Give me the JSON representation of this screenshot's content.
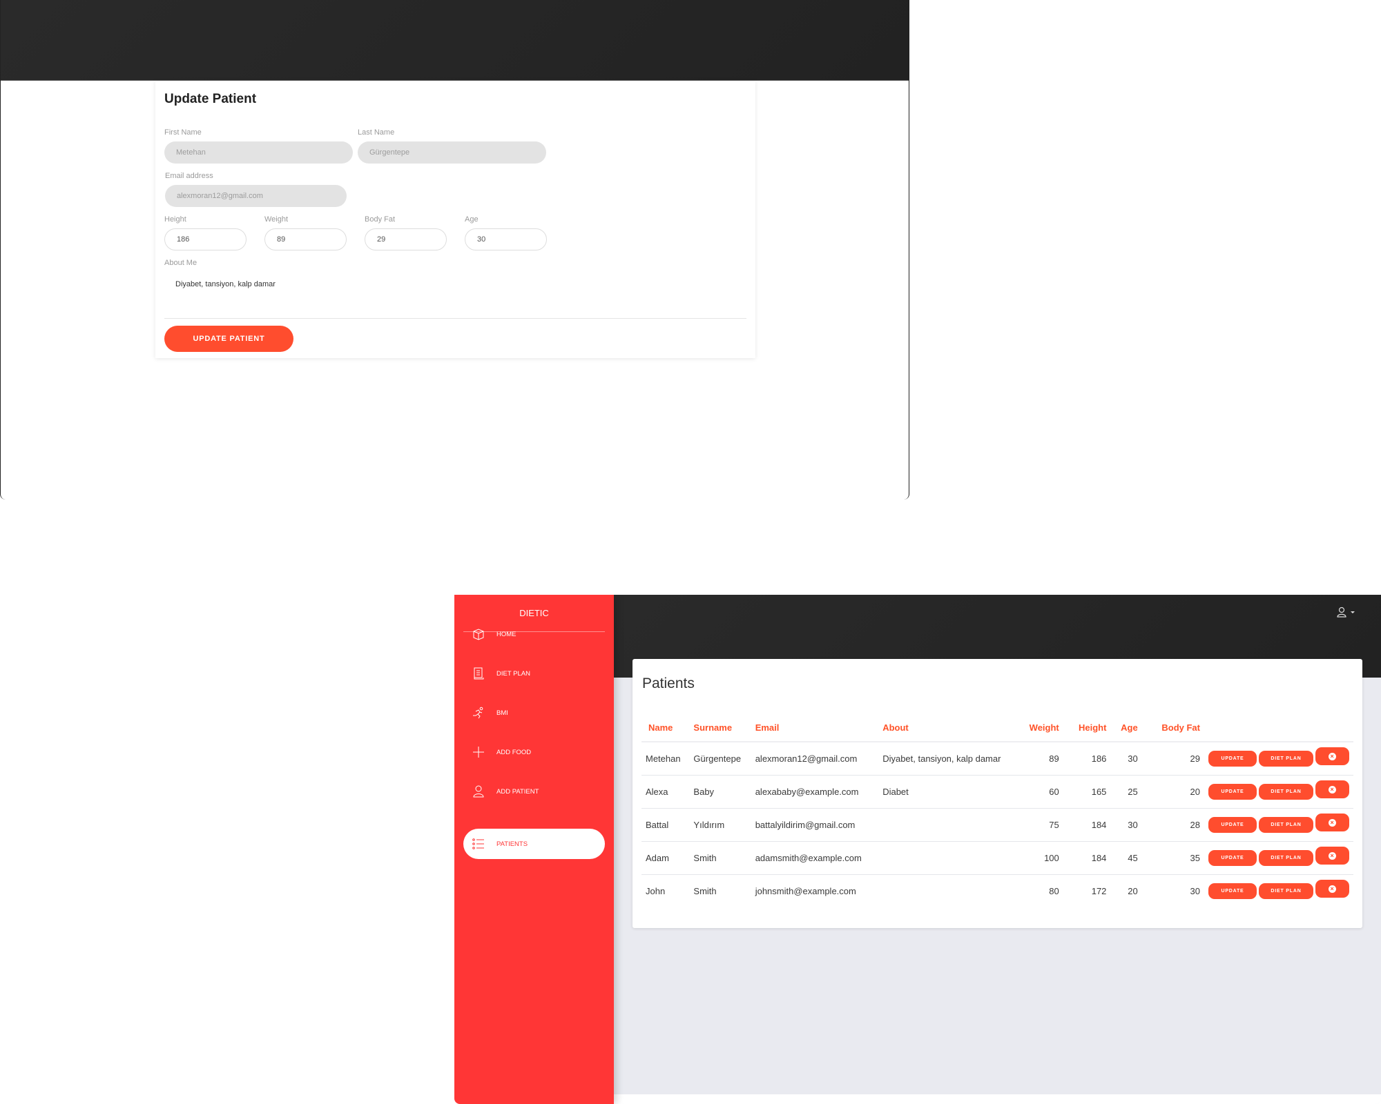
{
  "update_patient": {
    "title": "Update Patient",
    "fields": {
      "first_name": {
        "label": "First Name",
        "value": "Metehan"
      },
      "last_name": {
        "label": "Last Name",
        "value": "Gürgentepe"
      },
      "email": {
        "label": "Email address",
        "value": "alexmoran12@gmail.com"
      },
      "height": {
        "label": "Height",
        "value": "186"
      },
      "weight": {
        "label": "Weight",
        "value": "89"
      },
      "body_fat": {
        "label": "Body Fat",
        "value": "29"
      },
      "age": {
        "label": "Age",
        "value": "30"
      },
      "about": {
        "label": "About Me",
        "value": "Diyabet, tansiyon, kalp damar"
      }
    },
    "submit_label": "UPDATE PATIENT"
  },
  "sidebar": {
    "brand": "DIETIC",
    "items": [
      {
        "label": "HOME",
        "icon": "cube-icon"
      },
      {
        "label": "DIET PLAN",
        "icon": "document-icon"
      },
      {
        "label": "BMI",
        "icon": "runner-icon"
      },
      {
        "label": "ADD FOOD",
        "icon": "plus-icon"
      },
      {
        "label": "ADD PATIENT",
        "icon": "user-icon"
      },
      {
        "label": "PATIENTS",
        "icon": "list-icon",
        "active": true
      }
    ]
  },
  "header": {
    "user_icon": "user-icon",
    "dropdown": "caret-down-icon"
  },
  "patients": {
    "title": "Patients",
    "columns": [
      "Name",
      "Surname",
      "Email",
      "About",
      "Weight",
      "Height",
      "Age",
      "Body Fat"
    ],
    "rows": [
      {
        "name": "Metehan",
        "surname": "Gürgentepe",
        "email": "alexmoran12@gmail.com",
        "about": "Diyabet, tansiyon, kalp damar",
        "weight": "89",
        "height": "186",
        "age": "30",
        "body_fat": "29"
      },
      {
        "name": "Alexa",
        "surname": "Baby",
        "email": "alexababy@example.com",
        "about": "Diabet",
        "weight": "60",
        "height": "165",
        "age": "25",
        "body_fat": "20"
      },
      {
        "name": "Battal",
        "surname": "Yıldırım",
        "email": "battalyildirim@gmail.com",
        "about": "",
        "weight": "75",
        "height": "184",
        "age": "30",
        "body_fat": "28"
      },
      {
        "name": "Adam",
        "surname": "Smith",
        "email": "adamsmith@example.com",
        "about": "",
        "weight": "100",
        "height": "184",
        "age": "45",
        "body_fat": "35"
      },
      {
        "name": "John",
        "surname": "Smith",
        "email": "johnsmith@example.com",
        "about": "",
        "weight": "80",
        "height": "172",
        "age": "20",
        "body_fat": "30"
      }
    ],
    "actions": {
      "update": "UPDATE",
      "diet_plan": "DIET PLAN",
      "delete_icon": "close-circle-icon"
    }
  },
  "colors": {
    "accent": "#ff4d2e",
    "sidebar": "#ff3636",
    "topbar": "#232323",
    "header_text": "#ff5228"
  }
}
